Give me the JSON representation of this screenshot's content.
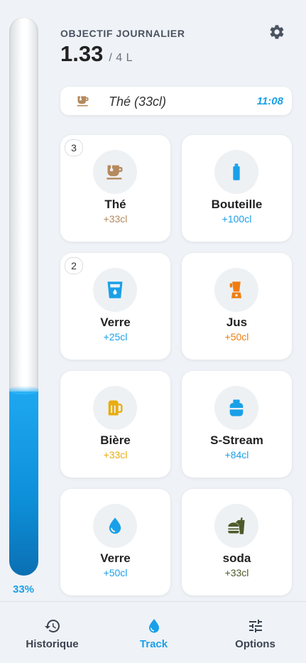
{
  "gauge": {
    "percent_label": "33%",
    "fill_fraction": 0.33
  },
  "header": {
    "goal_label": "OBJECTIF JOURNALIER",
    "current_liters": "1.33",
    "goal_suffix": "/ 4 L"
  },
  "last_drink": {
    "name": "Thé (33cl)",
    "time": "11:08",
    "icon": "tea-cup-icon"
  },
  "drinks": [
    {
      "name": "Thé",
      "amount": "+33cl",
      "badge": "3",
      "icon": "tea-cup-icon",
      "color": "#b58a5e"
    },
    {
      "name": "Bouteille",
      "amount": "+100cl",
      "badge": "",
      "icon": "bottle-icon",
      "color": "#1aa0e8"
    },
    {
      "name": "Verre",
      "amount": "+25cl",
      "badge": "2",
      "icon": "glass-water-icon",
      "color": "#1aa0e8"
    },
    {
      "name": "Jus",
      "amount": "+50cl",
      "badge": "",
      "icon": "blender-icon",
      "color": "#ef7d10"
    },
    {
      "name": "Bière",
      "amount": "+33cl",
      "badge": "",
      "icon": "beer-mug-icon",
      "color": "#e8ad10"
    },
    {
      "name": "S-Stream",
      "amount": "+84cl",
      "badge": "",
      "icon": "soda-stream-icon",
      "color": "#1aa0e8"
    },
    {
      "name": "Verre",
      "amount": "+50cl",
      "badge": "",
      "icon": "droplet-icon",
      "color": "#1aa0e8"
    },
    {
      "name": "soda",
      "amount": "+33cl",
      "badge": "",
      "icon": "burger-soda-icon",
      "color": "#4f5a2a"
    }
  ],
  "nav": [
    {
      "label": "Historique",
      "icon": "history-icon",
      "active": false
    },
    {
      "label": "Track",
      "icon": "droplet-icon",
      "active": true
    },
    {
      "label": "Options",
      "icon": "sliders-icon",
      "active": false
    }
  ],
  "colors": {
    "accent": "#1aa0e8",
    "inactive": "#3a4350"
  }
}
